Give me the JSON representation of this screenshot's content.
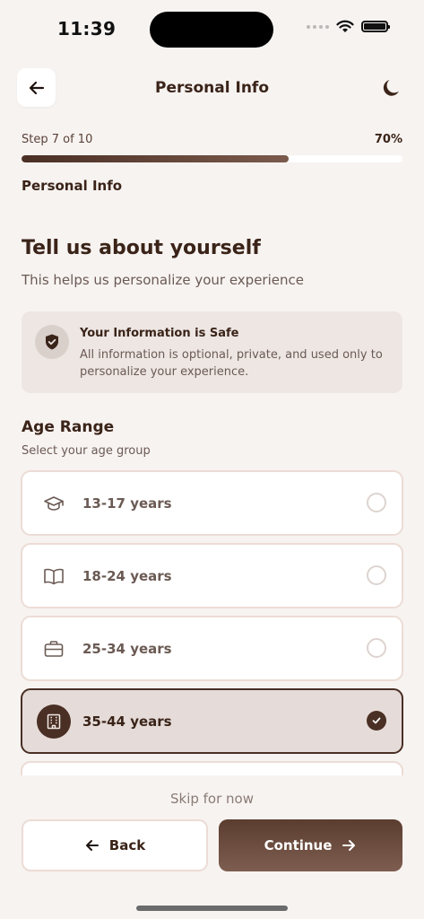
{
  "status_bar": {
    "time": "11:39"
  },
  "nav": {
    "title": "Personal Info",
    "back_icon": "arrow-left-icon",
    "theme_icon": "moon-icon"
  },
  "progress": {
    "step_label": "Step 7 of 10",
    "percent_label": "70%",
    "fraction": 0.7,
    "section_name": "Personal Info"
  },
  "intro": {
    "heading": "Tell us about yourself",
    "subheading": "This helps us personalize your experience"
  },
  "safe_notice": {
    "icon": "shield-check-icon",
    "title": "Your Information is Safe",
    "text": "All information is optional, private, and used only to personalize your experience."
  },
  "age_range": {
    "title": "Age Range",
    "subtitle": "Select your age group",
    "options": [
      {
        "label": "13-17 years",
        "icon": "graduation-cap-icon",
        "selected": false
      },
      {
        "label": "18-24 years",
        "icon": "book-open-icon",
        "selected": false
      },
      {
        "label": "25-34 years",
        "icon": "briefcase-icon",
        "selected": false
      },
      {
        "label": "35-44 years",
        "icon": "building-icon",
        "selected": true
      }
    ]
  },
  "footer": {
    "skip": "Skip for now",
    "back_label": "Back",
    "continue_label": "Continue"
  },
  "colors": {
    "primary": "#4a2f24",
    "background": "#f7f3f1",
    "card": "#ede6e3"
  }
}
